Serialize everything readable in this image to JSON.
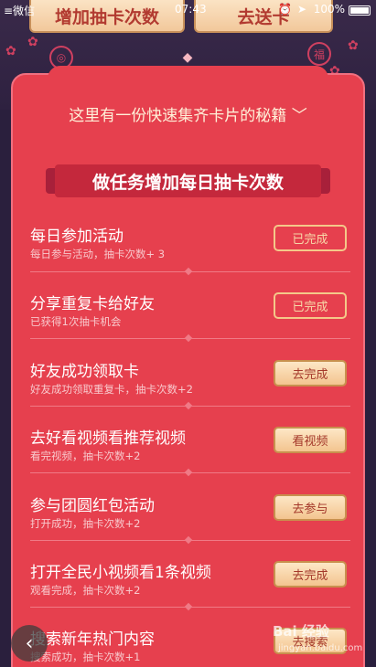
{
  "status_bar": {
    "carrier": "≡微信",
    "time": "07:43",
    "battery": "100%"
  },
  "top_tabs": {
    "left": "增加抽卡次数",
    "right": "去送卡"
  },
  "secret_line": "这里有一份快速集齐卡片的秘籍",
  "banner": "做任务增加每日抽卡次数",
  "tasks": [
    {
      "title": "每日参加活动",
      "subtitle": "每日参与活动，抽卡次数+ 3",
      "button": "已完成",
      "state": "done"
    },
    {
      "title": "分享重复卡给好友",
      "subtitle": "已获得1次抽卡机会",
      "button": "已完成",
      "state": "done"
    },
    {
      "title": "好友成功领取卡",
      "subtitle": "好友成功领取重复卡，抽卡次数+2",
      "button": "去完成",
      "state": "active"
    },
    {
      "title": "去好看视频看推荐视频",
      "subtitle": "看完视频，抽卡次数+2",
      "button": "看视频",
      "state": "active"
    },
    {
      "title": "参与团圆红包活动",
      "subtitle": "打开成功，抽卡次数+2",
      "button": "去参与",
      "state": "active"
    },
    {
      "title": "打开全民小视频看1条视频",
      "subtitle": "观看完成，抽卡次数+2",
      "button": "去完成",
      "state": "active"
    },
    {
      "title": "搜索新年热门内容",
      "subtitle": "搜索成功，抽卡次数+1",
      "button": "去搜索",
      "state": "active"
    }
  ],
  "watermark": {
    "main": "Bai 经验",
    "sub": "jingyan.baidu.com"
  },
  "colors": {
    "panel": "#e6404e",
    "banner": "#c4283c",
    "button_done_border": "#f4c889",
    "button_active_bg": "#f3c48f"
  }
}
